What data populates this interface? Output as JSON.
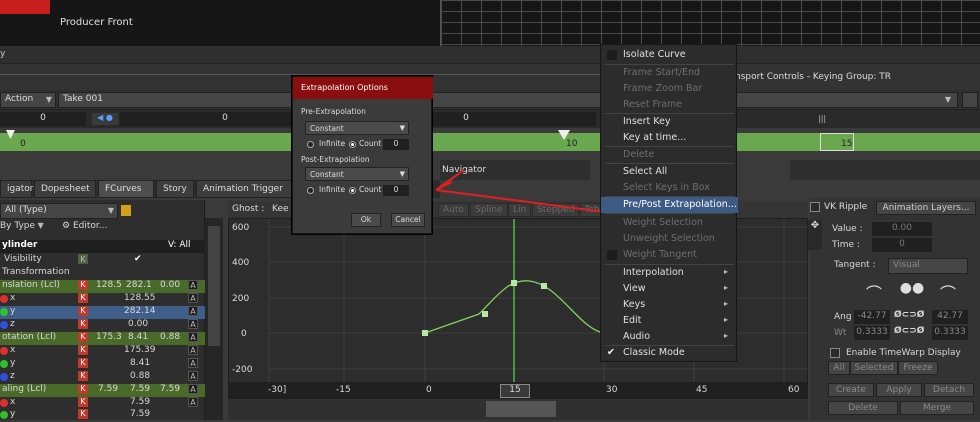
{
  "viewer": {
    "title": "Producer Front"
  },
  "transport": {
    "label": "nsport Controls  -  Keying Group: TR"
  },
  "action": {
    "mode": "Action",
    "take": "Take 001"
  },
  "frames": {
    "left_value": "0",
    "mid_value": "0",
    "right_value": "0"
  },
  "timeline": {
    "mark0": "0",
    "mark10": "10",
    "mark15": "15"
  },
  "tabs": [
    "igator",
    "Dopesheet",
    "FCurves",
    "Story",
    "Animation Trigger"
  ],
  "filter": {
    "type": "All (Type)",
    "by_type": "By Type",
    "editor": "Editor..."
  },
  "navigator_label": "Navigator",
  "tree": {
    "header": "ylinder",
    "v_all": "V: All",
    "rows": [
      {
        "label": "Visibility"
      },
      {
        "label": "Transformation"
      },
      {
        "label": "nslation (Lcl)",
        "v1": "128.5",
        "v2": "282.1",
        "v3": "0.00"
      },
      {
        "label": "x",
        "v1": "128.55"
      },
      {
        "label": "y",
        "v1": "282.14"
      },
      {
        "label": "z",
        "v1": "0.00"
      },
      {
        "label": "otation (Lcl)",
        "v1": "175.3",
        "v2": "8.41",
        "v3": "0.88"
      },
      {
        "label": "x",
        "v1": "175.39"
      },
      {
        "label": "y",
        "v1": "8.41"
      },
      {
        "label": "z",
        "v1": "0.88"
      },
      {
        "label": "aling (Lcl)",
        "v1": "7.59",
        "v2": "7.59",
        "v3": "7.59"
      },
      {
        "label": "x",
        "v1": "7.59"
      },
      {
        "label": "y",
        "v1": "7.59"
      }
    ]
  },
  "ghost": {
    "label": "Ghost :",
    "value": "Kee",
    "buttons": [
      "Auto",
      "Spline",
      "Lin",
      "Stepped",
      "Tcb"
    ]
  },
  "graph": {
    "y_ticks": [
      "600",
      "400",
      "200",
      "0",
      "-200"
    ],
    "x_ticks": [
      "-30]",
      "-15",
      "0",
      "15",
      "30",
      "45",
      "60"
    ],
    "current_frame": "15",
    "curve_color": "#7fd35f"
  },
  "dialog": {
    "title": "Extrapolation Options",
    "pre_label": "Pre-Extrapolation",
    "pre_value": "Constant",
    "post_label": "Post-Extrapolation",
    "post_value": "Constant",
    "infinite": "Infinite",
    "count": "Count",
    "count_value": "0",
    "ok": "Ok",
    "cancel": "Cancel"
  },
  "menu": {
    "items": [
      {
        "label": "Isolate Curve",
        "state": "enabled",
        "check": true
      },
      {
        "label": "Frame Start/End",
        "state": "disabled"
      },
      {
        "label": "Frame Zoom Bar",
        "state": "disabled"
      },
      {
        "label": "Reset Frame",
        "state": "disabled"
      },
      {
        "label": "Insert Key",
        "state": "enabled"
      },
      {
        "label": "Key at time...",
        "state": "enabled"
      },
      {
        "label": "Delete",
        "state": "disabled"
      },
      {
        "label": "Select All",
        "state": "enabled"
      },
      {
        "label": "Select Keys in Box",
        "state": "disabled"
      },
      {
        "label": "Pre/Post Extrapolation...",
        "state": "highlight"
      },
      {
        "label": "Weight Selection",
        "state": "disabled"
      },
      {
        "label": "Unweight Selection",
        "state": "disabled"
      },
      {
        "label": "Weight Tangent",
        "state": "disabled",
        "check": true
      },
      {
        "label": "Interpolation",
        "state": "enabled",
        "sub": true
      },
      {
        "label": "View",
        "state": "enabled",
        "sub": true
      },
      {
        "label": "Keys",
        "state": "enabled",
        "sub": true
      },
      {
        "label": "Edit",
        "state": "enabled",
        "sub": true
      },
      {
        "label": "Audio",
        "state": "enabled",
        "sub": true
      },
      {
        "label": "Classic Mode",
        "state": "enabled",
        "checked": "✔"
      }
    ]
  },
  "right": {
    "vk_ripple": "VK Ripple",
    "anim_layers": "Animation Layers...",
    "value_label": "Value :",
    "value": "0.00",
    "time_label": "Time :",
    "time": "0",
    "tangent_label": "Tangent :",
    "tangent_value": "Visual",
    "ang_label": "Ang",
    "ang_left": "-42.77",
    "ang_right": "42.77",
    "wt_label": "Wt",
    "wt_left": "0.3333",
    "wt_right": "0.3333",
    "timewarp": "Enable TimeWarp Display",
    "all": "All",
    "selected": "Selected",
    "freeze": "Freeze",
    "create": "Create",
    "apply": "Apply",
    "detach": "Detach",
    "delete": "Delete",
    "merge": "Merge"
  }
}
